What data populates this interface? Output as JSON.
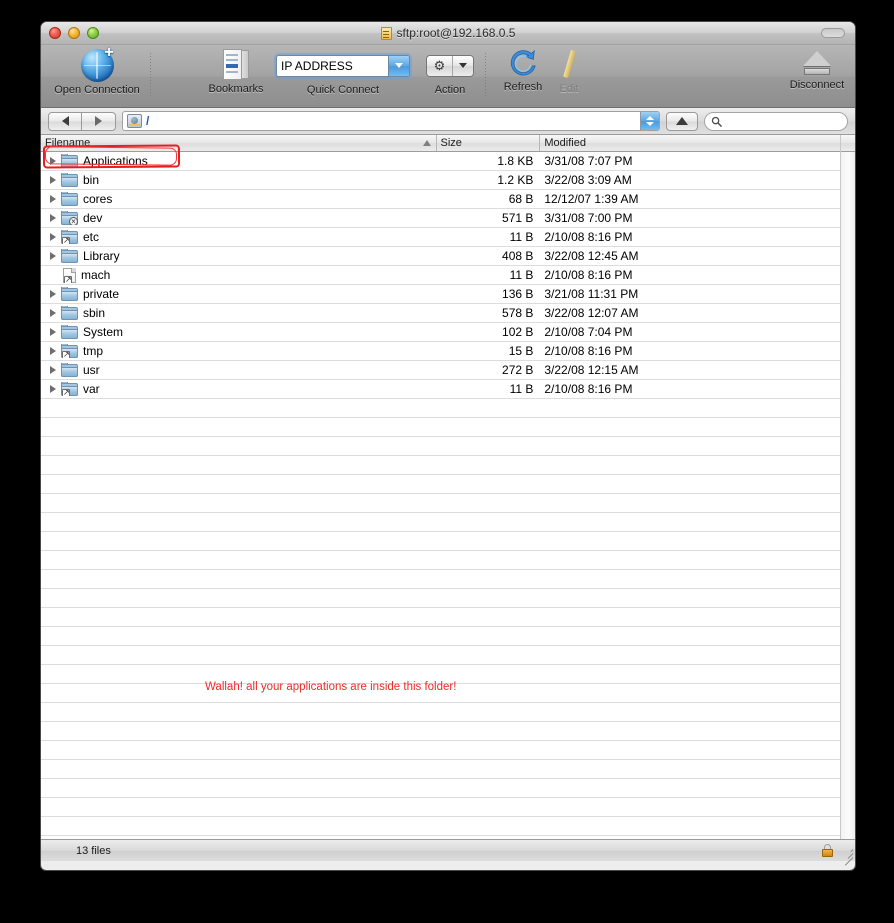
{
  "window": {
    "title": "sftp:root@192.168.0.5",
    "title_icon": "locked-document-icon",
    "close_label": "Close",
    "minimize_label": "Minimize",
    "zoom_label": "Zoom"
  },
  "toolbar": {
    "items": [
      {
        "label": "Open Connection",
        "icon": "globe-plus-icon"
      },
      {
        "label": "Bookmarks",
        "icon": "bookmarks-icon"
      },
      {
        "label": "Quick Connect",
        "icon": "combo-box-icon"
      },
      {
        "label": "Action",
        "icon": "gear-icon"
      },
      {
        "label": "Refresh",
        "icon": "refresh-arrow-icon"
      },
      {
        "label": "Edit",
        "icon": "pencil-icon",
        "disabled": true
      },
      {
        "label": "Disconnect",
        "icon": "eject-icon"
      }
    ],
    "quick_connect": {
      "value": "IP ADDRESS",
      "placeholder": "IP ADDRESS"
    }
  },
  "navbar": {
    "back_label": "Back",
    "forward_label": "Forward",
    "path": "/",
    "path_icon": "hard-disk-icon",
    "up_label": "Up",
    "search": {
      "value": "",
      "placeholder": ""
    }
  },
  "filelist": {
    "columns": [
      {
        "key": "name",
        "label": "Filename",
        "sorted": "asc"
      },
      {
        "key": "size",
        "label": "Size"
      },
      {
        "key": "modified",
        "label": "Modified"
      }
    ],
    "rows": [
      {
        "name": "Applications",
        "size": "1.8 KB",
        "modified": "3/31/08 7:07 PM",
        "icon": "folder-icon",
        "expandable": true,
        "highlighted": true
      },
      {
        "name": "bin",
        "size": "1.2 KB",
        "modified": "3/22/08 3:09 AM",
        "icon": "folder-icon",
        "expandable": true
      },
      {
        "name": "cores",
        "size": "68 B",
        "modified": "12/12/07 1:39 AM",
        "icon": "folder-icon",
        "expandable": true
      },
      {
        "name": "dev",
        "size": "571 B",
        "modified": "3/31/08 7:00 PM",
        "icon": "folder-device-icon",
        "expandable": true
      },
      {
        "name": "etc",
        "size": "11 B",
        "modified": "2/10/08 8:16 PM",
        "icon": "folder-alias-icon",
        "expandable": true
      },
      {
        "name": "Library",
        "size": "408 B",
        "modified": "3/22/08 12:45 AM",
        "icon": "folder-icon",
        "expandable": true
      },
      {
        "name": "mach",
        "size": "11 B",
        "modified": "2/10/08 8:16 PM",
        "icon": "file-alias-icon",
        "expandable": false
      },
      {
        "name": "private",
        "size": "136 B",
        "modified": "3/21/08 11:31 PM",
        "icon": "folder-icon",
        "expandable": true
      },
      {
        "name": "sbin",
        "size": "578 B",
        "modified": "3/22/08 12:07 AM",
        "icon": "folder-icon",
        "expandable": true
      },
      {
        "name": "System",
        "size": "102 B",
        "modified": "2/10/08 7:04 PM",
        "icon": "folder-icon",
        "expandable": true
      },
      {
        "name": "tmp",
        "size": "15 B",
        "modified": "2/10/08 8:16 PM",
        "icon": "folder-alias-icon",
        "expandable": true
      },
      {
        "name": "usr",
        "size": "272 B",
        "modified": "3/22/08 12:15 AM",
        "icon": "folder-icon",
        "expandable": true
      },
      {
        "name": "var",
        "size": "11 B",
        "modified": "2/10/08 8:16 PM",
        "icon": "folder-alias-icon",
        "expandable": true
      }
    ]
  },
  "annotation": {
    "text": "Wallah! all your applications are inside this folder!",
    "color": "#ee2b2b",
    "highlight_target": "Applications"
  },
  "statusbar": {
    "file_count": "13 files",
    "lock_icon": "locked-padlock-icon"
  }
}
